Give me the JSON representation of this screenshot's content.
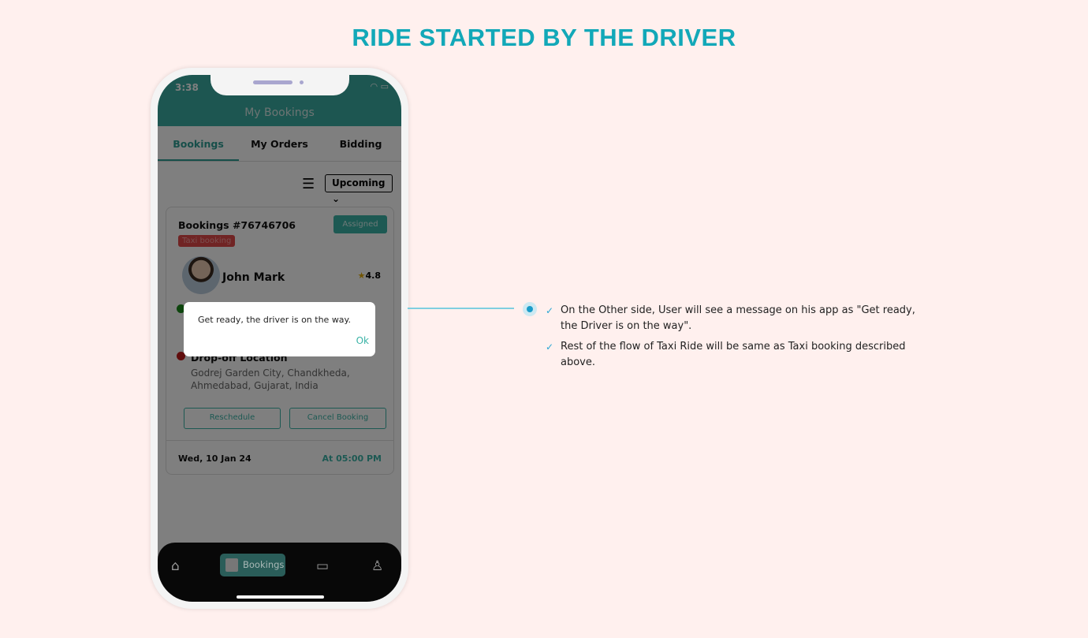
{
  "title": "RIDE STARTED BY THE DRIVER",
  "phone": {
    "status": {
      "time": "3:38",
      "icons": "wifi battery-charging"
    },
    "header": "My Bookings",
    "tabs": [
      {
        "label": "Bookings",
        "active": true
      },
      {
        "label": "My Orders"
      },
      {
        "label": "Bidding"
      }
    ],
    "filter": {
      "selected": "Upcoming",
      "icon": "sliders-icon"
    },
    "card": {
      "booking": "Bookings #76746706",
      "type_tag": "Taxi booking",
      "status": "Assigned",
      "driver": "John Mark",
      "rating": "4.8",
      "dropoff_label": "Drop-off Location",
      "dropoff_address": "Godrej Garden City, Chandkheda, Ahmedabad, Gujarat, India",
      "reschedule": "Reschedule",
      "cancel": "Cancel Booking",
      "date": "Wed, 10 Jan 24",
      "time": "At 05:00 PM"
    },
    "dialog": {
      "message": "Get ready, the driver is on the way.",
      "ok": "Ok"
    },
    "nav": {
      "active": "Bookings"
    }
  },
  "notes": [
    "On the Other side, User will see a message on his app as \"Get ready, the Driver is on the way\".",
    "Rest of the flow of Taxi Ride will be same as Taxi booking described above."
  ],
  "colors": {
    "accent": "#12a8b8",
    "teal": "#3ab3a6",
    "background": "#fff0ee"
  }
}
